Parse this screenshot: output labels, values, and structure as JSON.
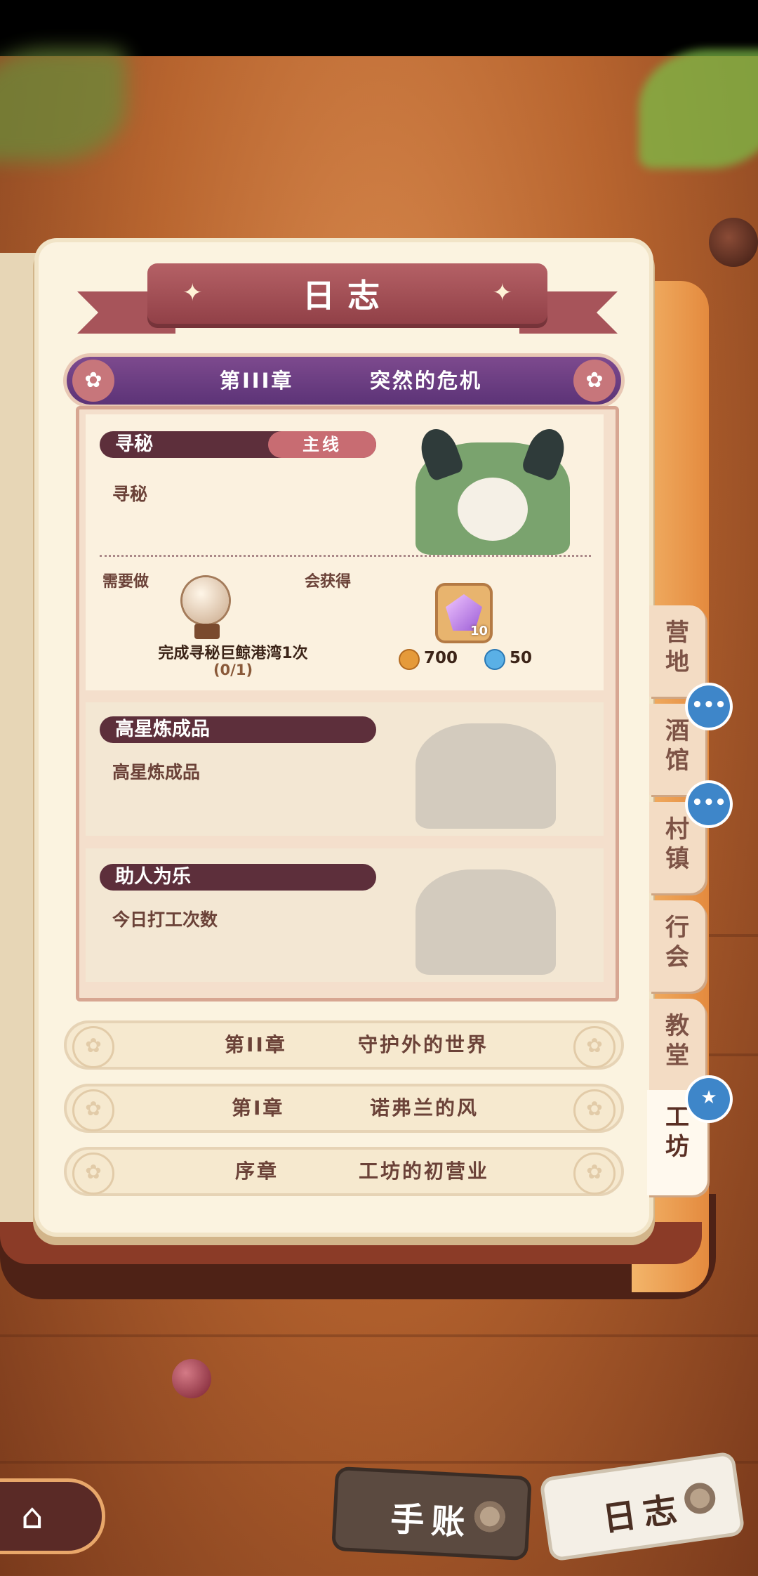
{
  "journal": {
    "title": "日志",
    "current_chapter": {
      "number": "第III章",
      "name": "突然的危机"
    },
    "quests": [
      {
        "name": "寻秘",
        "tag": "主线",
        "description": "寻秘",
        "requirement_label": "需要做",
        "reward_label": "会获得",
        "task": "完成寻秘巨鲸港湾1次",
        "progress": "(0/1)",
        "reward_item_count": "10",
        "reward_coins": "700",
        "reward_water": "50"
      },
      {
        "name": "高星炼成品",
        "description": "高星炼成品"
      },
      {
        "name": "助人为乐",
        "description": "今日打工次数"
      }
    ],
    "chapters": [
      {
        "number": "第II章",
        "name": "守护外的世界"
      },
      {
        "number": "第I章",
        "name": "诺弗兰的风"
      },
      {
        "number": "序章",
        "name": "工坊的初营业"
      }
    ]
  },
  "side_tabs": [
    "营地",
    "酒馆",
    "村镇",
    "行会",
    "教堂",
    "工坊"
  ],
  "active_tab": "工坊",
  "bottom": {
    "handbook_label": "手账",
    "journal_label": "日志"
  },
  "colors": {
    "ribbon": "#9b474e",
    "chapter_bar": "#6b3d82",
    "quest_header": "#5d2f3b",
    "quest_tag": "#c86c72",
    "bubble": "#3e86c9"
  }
}
